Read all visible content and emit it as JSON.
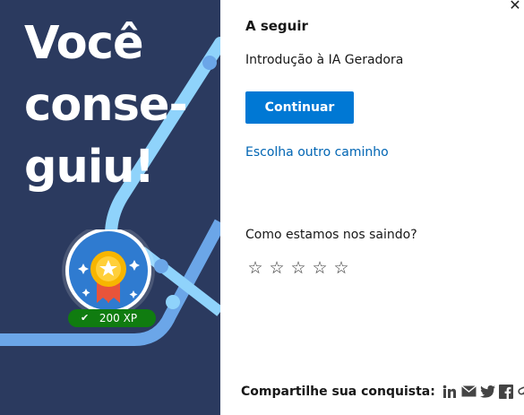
{
  "celebration": {
    "headline_lines": [
      "Você",
      "conse-",
      "guiu!"
    ],
    "xp_badge": "200 XP"
  },
  "next_panel": {
    "title": "A seguir",
    "module_name": "Introdução à IA Geradora",
    "continue_label": "Continuar",
    "other_path_label": "Escolha outro caminho",
    "close_icon": "close-icon"
  },
  "feedback": {
    "question": "Como estamos nos saindo?",
    "stars": [
      "star-1",
      "star-2",
      "star-3",
      "star-4",
      "star-5"
    ],
    "star_glyph": "☆"
  },
  "share": {
    "label": "Compartilhe sua conquista:",
    "icons": [
      "linkedin-icon",
      "email-icon",
      "twitter-icon",
      "facebook-icon",
      "link-icon"
    ]
  },
  "colors": {
    "left_bg": "#2b3a5f",
    "accent": "#0078d4",
    "link": "#0065b3",
    "xp_green": "#107c10",
    "track_light": "#8fd3fb",
    "track_mid": "#6ba6e8"
  }
}
